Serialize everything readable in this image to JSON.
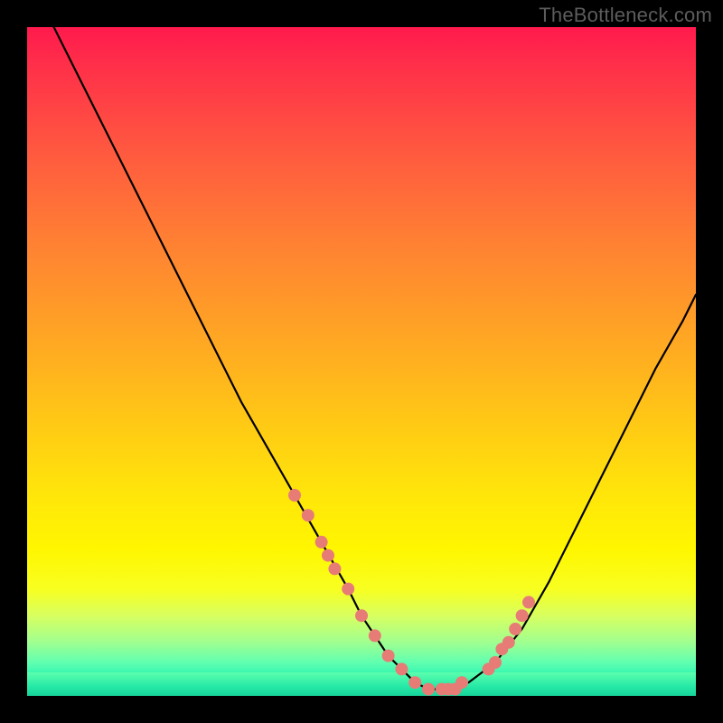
{
  "watermark": "TheBottleneck.com",
  "chart_data": {
    "type": "line",
    "title": "",
    "xlabel": "",
    "ylabel": "",
    "xlim": [
      0,
      100
    ],
    "ylim": [
      0,
      100
    ],
    "series": [
      {
        "name": "bottleneck-curve",
        "x": [
          4,
          8,
          12,
          16,
          20,
          24,
          28,
          32,
          36,
          40,
          44,
          48,
          50,
          52,
          54,
          56,
          58,
          60,
          62,
          64,
          66,
          70,
          74,
          78,
          82,
          86,
          90,
          94,
          98,
          100
        ],
        "y": [
          100,
          92,
          84,
          76,
          68,
          60,
          52,
          44,
          37,
          30,
          23,
          16,
          12,
          9,
          6,
          4,
          2,
          1,
          1,
          1,
          2,
          5,
          10,
          17,
          25,
          33,
          41,
          49,
          56,
          60
        ]
      }
    ],
    "markers": {
      "name": "highlight-dots",
      "color": "#e77c76",
      "x": [
        40,
        42,
        44,
        45,
        46,
        48,
        50,
        52,
        54,
        56,
        58,
        60,
        62,
        63,
        64,
        65,
        69,
        70,
        71,
        72,
        73,
        74,
        75
      ],
      "y": [
        30,
        27,
        23,
        21,
        19,
        16,
        12,
        9,
        6,
        4,
        2,
        1,
        1,
        1,
        1,
        2,
        4,
        5,
        7,
        8,
        10,
        12,
        14
      ]
    },
    "gradient_stops": [
      {
        "pos": 0,
        "color": "#ff1a4d"
      },
      {
        "pos": 18,
        "color": "#ff5740"
      },
      {
        "pos": 46,
        "color": "#ffa524"
      },
      {
        "pos": 78,
        "color": "#fff600"
      },
      {
        "pos": 92,
        "color": "#a0ff90"
      },
      {
        "pos": 100,
        "color": "#1ae8a8"
      }
    ]
  }
}
